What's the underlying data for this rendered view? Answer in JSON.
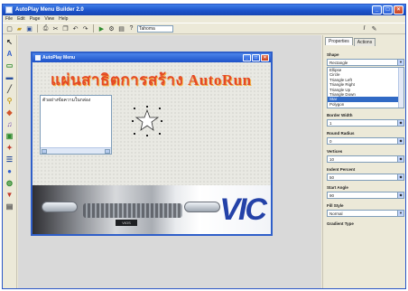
{
  "app": {
    "title": "AutoPlay Menu Builder 2.0"
  },
  "window_buttons": {
    "minimize": "_",
    "maximize": "□",
    "close": "×"
  },
  "menu": [
    "File",
    "Edit",
    "Page",
    "View",
    "Help"
  ],
  "toolbar": {
    "font_value": "Tahoma"
  },
  "design_window": {
    "title": "AutoPlay Menu",
    "headline": "แผ่นสาธิตการสร้าง AutoRun",
    "listbox_items": [
      "ตัวอย่างข้อความในกล่อง"
    ],
    "banner_brand": "VIC",
    "plate": "VIOS"
  },
  "panel": {
    "tabs": [
      "Properties",
      "Actions"
    ],
    "shape_label": "Shape",
    "shape_value": "Rectangle",
    "shape_options": [
      "Ellipse",
      "Circle",
      "Triangle Left",
      "Triangle Right",
      "Triangle Up",
      "Triangle Down",
      "Star",
      "Polygon"
    ],
    "selected_option": "Star",
    "fields": [
      {
        "label": "Border Width",
        "value": "1"
      },
      {
        "label": "Round Radius",
        "value": "0"
      },
      {
        "label": "Vertices",
        "value": "10"
      },
      {
        "label": "Indent Percent",
        "value": "50"
      },
      {
        "label": "Start Angle",
        "value": "90"
      },
      {
        "label": "Fill Style",
        "value": "Normal"
      }
    ],
    "last_label": "Gradient Type"
  },
  "colors": {
    "titlebar": "#1c52c9",
    "headline": "#e44a26",
    "brand": "#2442a8",
    "selection": "#316ac5"
  }
}
